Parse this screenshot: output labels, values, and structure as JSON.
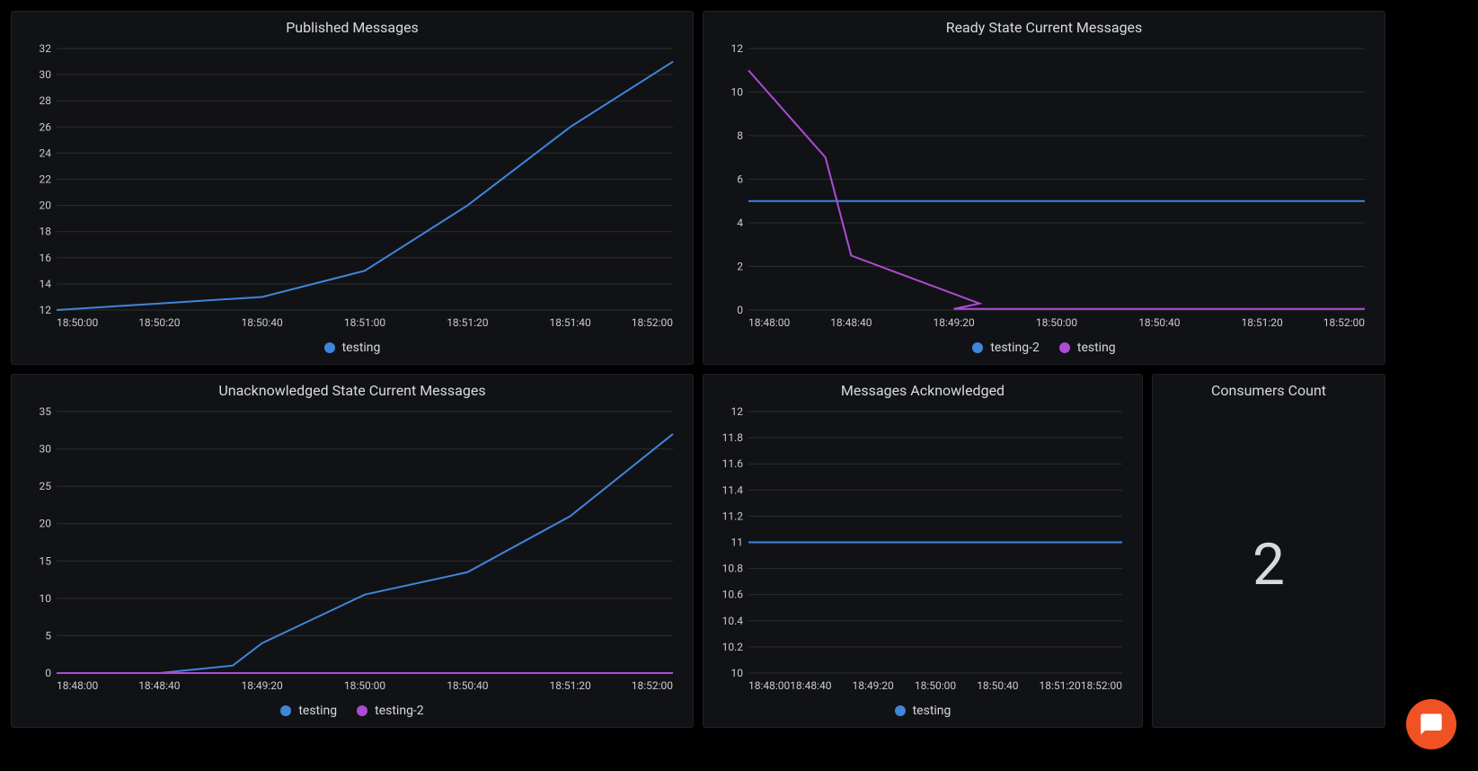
{
  "colors": {
    "testing": "#3f86d9",
    "testing2": "#ae4bd4"
  },
  "chart_data": [
    {
      "id": "published",
      "type": "line",
      "title": "Published Messages",
      "xlabel": "",
      "ylabel": "",
      "y_ticks": [
        12,
        14,
        16,
        18,
        20,
        22,
        24,
        26,
        28,
        30,
        32
      ],
      "ylim": [
        12,
        32
      ],
      "x_ticks": [
        "18:50:00",
        "18:50:20",
        "18:50:40",
        "18:51:00",
        "18:51:20",
        "18:51:40",
        "18:52:00"
      ],
      "series": [
        {
          "name": "testing",
          "color": "#3f86d9",
          "x": [
            "18:50:00",
            "18:50:20",
            "18:50:40",
            "18:51:00",
            "18:51:20",
            "18:51:40",
            "18:52:00"
          ],
          "values": [
            12.0,
            12.5,
            13.0,
            15.0,
            20.0,
            26.0,
            31.0
          ]
        }
      ]
    },
    {
      "id": "ready",
      "type": "line",
      "title": "Ready State Current Messages",
      "xlabel": "",
      "ylabel": "",
      "y_ticks": [
        0,
        2,
        4,
        6,
        8,
        10,
        12
      ],
      "ylim": [
        0,
        12
      ],
      "x_ticks": [
        "18:48:00",
        "18:48:40",
        "18:49:20",
        "18:50:00",
        "18:50:40",
        "18:51:20",
        "18:52:00"
      ],
      "series": [
        {
          "name": "testing-2",
          "color": "#3f86d9",
          "x": [
            "18:48:00",
            "18:48:40",
            "18:49:20",
            "18:50:00",
            "18:50:40",
            "18:51:20",
            "18:52:00"
          ],
          "values": [
            5,
            5,
            5,
            5,
            5,
            5,
            5
          ]
        },
        {
          "name": "testing",
          "color": "#ae4bd4",
          "x": [
            "18:48:00",
            "18:48:20",
            "18:48:40",
            "18:49:00",
            "18:49:20",
            "18:50:00",
            "18:50:40",
            "18:51:20",
            "18:52:00"
          ],
          "values": [
            11,
            7,
            2.5,
            0.3,
            0.05,
            0.05,
            0.05,
            0.05,
            0.05
          ]
        }
      ]
    },
    {
      "id": "unack",
      "type": "line",
      "title": "Unacknowledged State Current Messages",
      "xlabel": "",
      "ylabel": "",
      "y_ticks": [
        0,
        5,
        10,
        15,
        20,
        25,
        30,
        35
      ],
      "ylim": [
        0,
        35
      ],
      "x_ticks": [
        "18:48:00",
        "18:48:40",
        "18:49:20",
        "18:50:00",
        "18:50:40",
        "18:51:20",
        "18:52:00"
      ],
      "series": [
        {
          "name": "testing",
          "color": "#3f86d9",
          "x": [
            "18:48:00",
            "18:48:40",
            "18:49:00",
            "18:49:20",
            "18:50:00",
            "18:50:40",
            "18:51:20",
            "18:52:00"
          ],
          "values": [
            0,
            0,
            1,
            4,
            10.5,
            13.5,
            21,
            32
          ]
        },
        {
          "name": "testing-2",
          "color": "#ae4bd4",
          "x": [
            "18:48:00",
            "18:48:40",
            "18:49:20",
            "18:50:00",
            "18:50:40",
            "18:51:20",
            "18:52:00"
          ],
          "values": [
            0,
            0,
            0,
            0,
            0,
            0,
            0
          ]
        }
      ]
    },
    {
      "id": "ack",
      "type": "line",
      "title": "Messages Acknowledged",
      "xlabel": "",
      "ylabel": "",
      "y_ticks": [
        10,
        10.2,
        10.4,
        10.6,
        10.8,
        11,
        11.2,
        11.4,
        11.6,
        11.8,
        12
      ],
      "ylim": [
        10,
        12
      ],
      "x_ticks": [
        "18:48:00",
        "18:48:40",
        "18:49:20",
        "18:50:00",
        "18:50:40",
        "18:51:20",
        "18:52:00"
      ],
      "series": [
        {
          "name": "testing",
          "color": "#3f86d9",
          "x": [
            "18:48:00",
            "18:48:40",
            "18:49:20",
            "18:50:00",
            "18:50:40",
            "18:51:20",
            "18:52:00"
          ],
          "values": [
            11,
            11,
            11,
            11,
            11,
            11,
            11
          ]
        }
      ]
    }
  ],
  "consumers": {
    "title": "Consumers Count",
    "value": "2"
  },
  "legends": {
    "published": [
      {
        "name": "testing",
        "color": "#3f86d9"
      }
    ],
    "ready": [
      {
        "name": "testing-2",
        "color": "#3f86d9"
      },
      {
        "name": "testing",
        "color": "#ae4bd4"
      }
    ],
    "unack": [
      {
        "name": "testing",
        "color": "#3f86d9"
      },
      {
        "name": "testing-2",
        "color": "#ae4bd4"
      }
    ],
    "ack": [
      {
        "name": "testing",
        "color": "#3f86d9"
      }
    ]
  }
}
